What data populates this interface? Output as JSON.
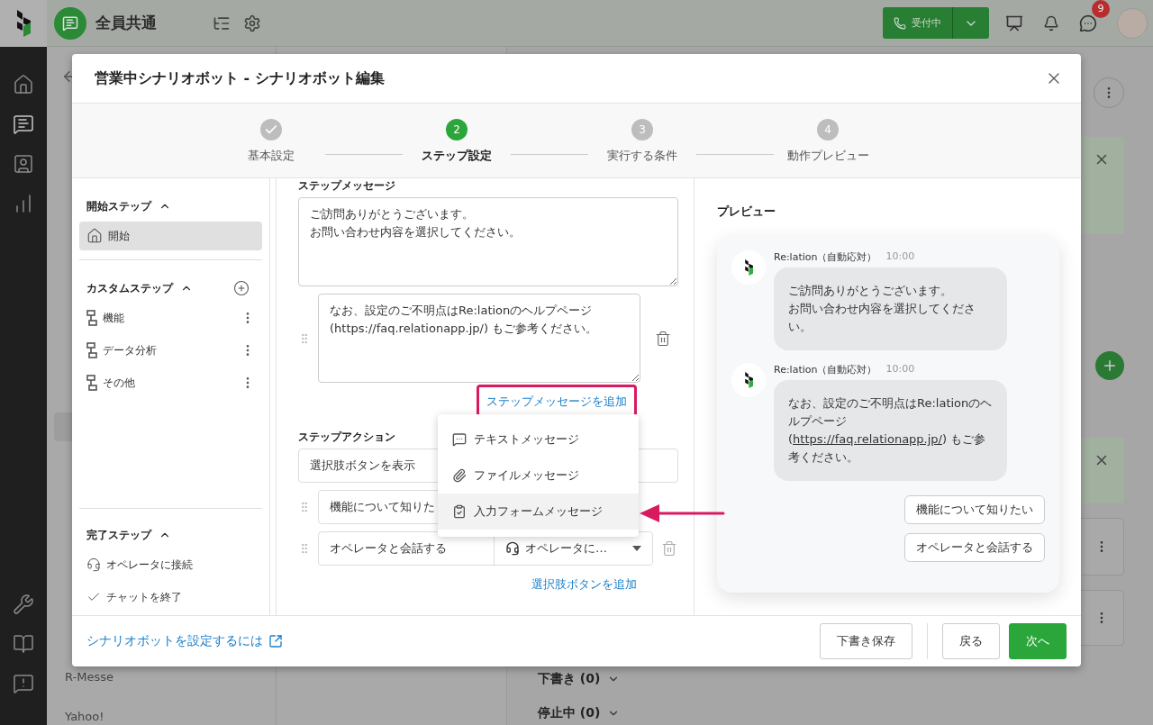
{
  "top_bar": {
    "workspace": "全員共通",
    "status_button": "受付中",
    "chat_badge": "9"
  },
  "nav_rail": [
    {
      "kind": "home",
      "selected": false
    },
    {
      "kind": "inbox",
      "selected": true
    },
    {
      "kind": "contacts",
      "selected": false
    },
    {
      "kind": "chart",
      "selected": false
    },
    {
      "kind": "tools",
      "selected": false
    },
    {
      "kind": "book",
      "selected": false
    },
    {
      "kind": "help",
      "selected": false
    }
  ],
  "background_list": [
    "R-Messe",
    "Yahoo!"
  ],
  "background_sections": [
    "下書き (0)",
    "停止中 (0)"
  ],
  "modal": {
    "title": "営業中シナリオボット - シナリオボット編集",
    "steps": [
      {
        "label": "基本設定",
        "completed": true,
        "selected": false
      },
      {
        "number": "2",
        "label": "ステップ設定",
        "completed": false,
        "selected": true
      },
      {
        "number": "3",
        "label": "実行する条件",
        "completed": false,
        "selected": false
      },
      {
        "number": "4",
        "label": "動作プレビュー",
        "completed": false,
        "selected": false
      }
    ],
    "sidebar": {
      "start": {
        "title": "開始ステップ",
        "expanded": true,
        "items": [
          {
            "label": "開始",
            "kind": "home",
            "selected": true
          }
        ]
      },
      "custom": {
        "title": "カスタムステップ",
        "expanded": true,
        "items": [
          {
            "label": "機能",
            "kind": "step",
            "selected": false
          },
          {
            "label": "データ分析",
            "kind": "step",
            "selected": false
          },
          {
            "label": "その他",
            "kind": "step",
            "selected": false
          }
        ]
      },
      "end": {
        "title": "完了ステップ",
        "expanded": true,
        "items": [
          {
            "label": "オペレータに接続",
            "kind": "operator",
            "selected": false
          },
          {
            "label": "チャットを終了",
            "kind": "finish",
            "selected": false
          }
        ]
      }
    },
    "editor": {
      "message_label": "ステップメッセージ",
      "first_message": [
        "ご訪問ありがとうございます。",
        "お問い合わせ内容を選択してください。"
      ],
      "extra_messages": [
        [
          "なお、設定のご不明点はRe:lationのヘルプページ",
          "(https://faq.relationapp.jp/) もご参考ください。"
        ]
      ],
      "add_message_link": "ステップメッセージを追加",
      "action_label": "ステップアクション",
      "action_select": "選択肢ボタンを表示",
      "choices": [
        {
          "label": "機能について知りた"
        },
        {
          "label": "オペレータと会話する",
          "target": "オペレータに…"
        }
      ],
      "add_choice_link": "選択肢ボタンを追加",
      "menu": [
        {
          "label": "テキストメッセージ",
          "kind": "text",
          "highlighted": false
        },
        {
          "label": "ファイルメッセージ",
          "kind": "file",
          "highlighted": false
        },
        {
          "label": "入力フォームメッセージ",
          "kind": "form",
          "highlighted": true
        }
      ]
    },
    "preview": {
      "title": "プレビュー",
      "messages": [
        {
          "sender": "Re:lation（自動応対）",
          "time": "10:00",
          "segments": [
            {
              "kind": "text",
              "text": "ご訪問ありがとうございます。"
            },
            {
              "kind": "break"
            },
            {
              "kind": "text",
              "text": "お問い合わせ内容を選択してください。"
            }
          ]
        },
        {
          "sender": "Re:lation（自動応対）",
          "time": "10:00",
          "segments": [
            {
              "kind": "text",
              "text": "なお、設定のご不明点はRe:lationのヘルプページ ("
            },
            {
              "kind": "link",
              "text": "https://faq.relationapp.jp/"
            },
            {
              "kind": "text",
              "text": ") もご参考ください。"
            }
          ]
        }
      ],
      "choices": [
        "機能について知りたい",
        "オペレータと会話する"
      ]
    },
    "footer": {
      "help_link": "シナリオボットを設定するには",
      "buttons": [
        {
          "label": "下書き保存",
          "kind": "secondary"
        },
        {
          "label": "戻る",
          "kind": "secondary"
        },
        {
          "label": "次へ",
          "kind": "primary"
        }
      ]
    }
  }
}
